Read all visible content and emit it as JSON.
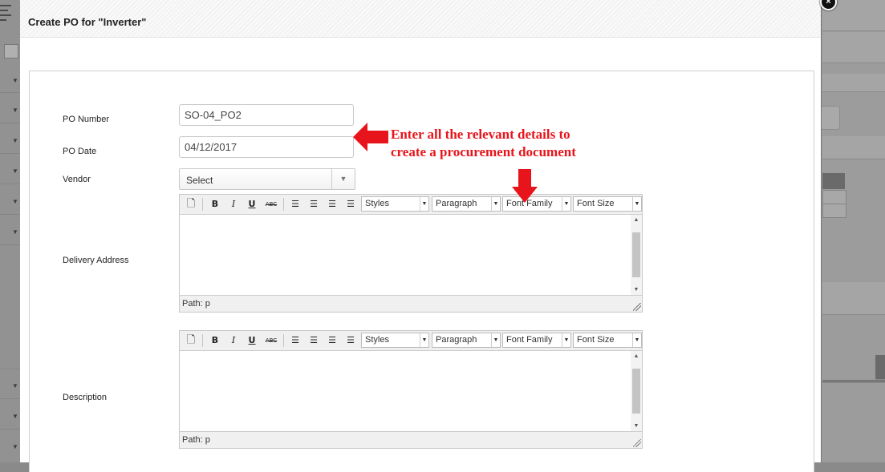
{
  "modal": {
    "title": "Create PO for \"Inverter\"",
    "close_icon": "close-icon"
  },
  "form": {
    "po_number": {
      "label": "PO Number",
      "value": "SO-04_PO2"
    },
    "po_date": {
      "label": "PO Date",
      "value": "04/12/2017"
    },
    "vendor": {
      "label": "Vendor",
      "selected": "Select"
    },
    "delivery_address": {
      "label": "Delivery Address",
      "path": "Path: p"
    },
    "description": {
      "label": "Description",
      "path": "Path: p"
    }
  },
  "editor_toolbar": {
    "styles": "Styles",
    "paragraph": "Paragraph",
    "font_family": "Font Family",
    "font_size": "Font Size",
    "bold": "B",
    "italic": "I",
    "underline": "U",
    "strike": "ABC"
  },
  "annotation": {
    "line1": "Enter all the relevant details to",
    "line2": "create a procurement document",
    "color": "#e8141b"
  }
}
